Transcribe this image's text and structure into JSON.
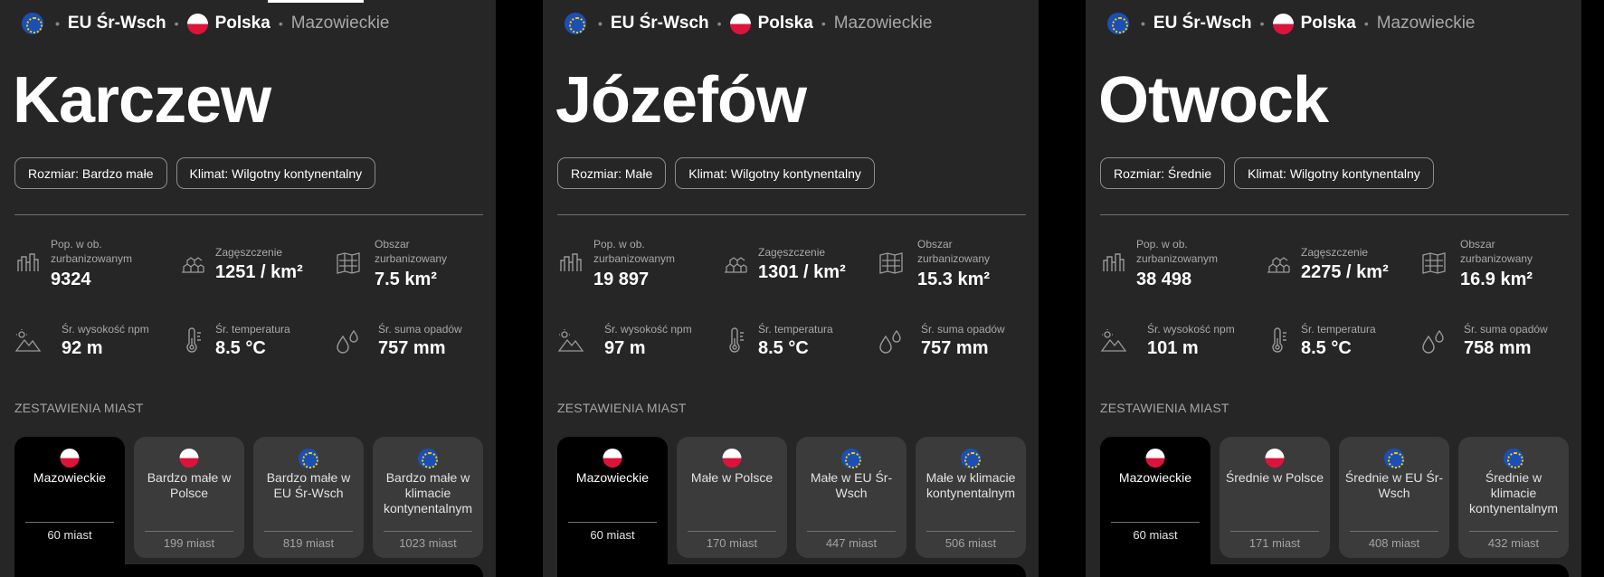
{
  "panels": [
    {
      "crumbs": {
        "region": "EU Śr-Wsch",
        "country": "Polska",
        "province": "Mazowieckie"
      },
      "title": "Karczew",
      "tags": {
        "size": "Rozmiar: Bardzo małe",
        "climate": "Klimat: Wilgotny kontynentalny"
      },
      "stats": {
        "pop_label": "Pop. w ob. zurbanizowanym",
        "pop_value": "9324",
        "density_label": "Zagęszczenie",
        "density_value": "1251 / km²",
        "area_label": "Obszar zurbanizowany",
        "area_value": "7.5 km²",
        "elev_label": "Śr. wysokość npm",
        "elev_value": "92 m",
        "temp_label": "Śr. temperatura",
        "temp_value": "8.5 °C",
        "rain_label": "Śr. suma opadów",
        "rain_value": "757 mm"
      },
      "section": "ZESTAWIENIA MIAST",
      "cards": [
        {
          "title": "Mazowieckie",
          "count": "60 miast"
        },
        {
          "title": "Bardzo małe w Polsce",
          "count": "199 miast"
        },
        {
          "title": "Bardzo małe w EU Śr-Wsch",
          "count": "819 miast"
        },
        {
          "title": "Bardzo małe w klimacie kontynentalnym",
          "count": "1023 miast"
        }
      ]
    },
    {
      "crumbs": {
        "region": "EU Śr-Wsch",
        "country": "Polska",
        "province": "Mazowieckie"
      },
      "title": "Józefów",
      "tags": {
        "size": "Rozmiar: Małe",
        "climate": "Klimat: Wilgotny kontynentalny"
      },
      "stats": {
        "pop_label": "Pop. w ob. zurbanizowanym",
        "pop_value": "19 897",
        "density_label": "Zagęszczenie",
        "density_value": "1301 / km²",
        "area_label": "Obszar zurbanizowany",
        "area_value": "15.3 km²",
        "elev_label": "Śr. wysokość npm",
        "elev_value": "97 m",
        "temp_label": "Śr. temperatura",
        "temp_value": "8.5 °C",
        "rain_label": "Śr. suma opadów",
        "rain_value": "757 mm"
      },
      "section": "ZESTAWIENIA MIAST",
      "cards": [
        {
          "title": "Mazowieckie",
          "count": "60 miast"
        },
        {
          "title": "Małe w Polsce",
          "count": "170 miast"
        },
        {
          "title": "Małe w EU Śr-Wsch",
          "count": "447 miast"
        },
        {
          "title": "Małe w klimacie kontynentalnym",
          "count": "506 miast"
        }
      ]
    },
    {
      "crumbs": {
        "region": "EU Śr-Wsch",
        "country": "Polska",
        "province": "Mazowieckie"
      },
      "title": "Otwock",
      "tags": {
        "size": "Rozmiar: Średnie",
        "climate": "Klimat: Wilgotny kontynentalny"
      },
      "stats": {
        "pop_label": "Pop. w ob. zurbanizowanym",
        "pop_value": "38 498",
        "density_label": "Zagęszczenie",
        "density_value": "2275 / km²",
        "area_label": "Obszar zurbanizowany",
        "area_value": "16.9 km²",
        "elev_label": "Śr. wysokość npm",
        "elev_value": "101 m",
        "temp_label": "Śr. temperatura",
        "temp_value": "8.5 °C",
        "rain_label": "Śr. suma opadów",
        "rain_value": "758 mm"
      },
      "section": "ZESTAWIENIA MIAST",
      "cards": [
        {
          "title": "Mazowieckie",
          "count": "60 miast"
        },
        {
          "title": "Średnie w Polsce",
          "count": "171 miast"
        },
        {
          "title": "Średnie w EU Śr-Wsch",
          "count": "408 miast"
        },
        {
          "title": "Średnie w klimacie kontynentalnym",
          "count": "432 miast"
        }
      ]
    }
  ],
  "icons": {
    "region": "eu-flag-icon",
    "country": "poland-flag-icon",
    "population": "city-skyline-icon",
    "density": "stacked-houses-icon",
    "area": "city-map-icon",
    "elevation": "mountain-sun-icon",
    "temperature": "thermometer-icon",
    "precipitation": "rain-drops-icon"
  },
  "colors": {
    "panel_bg": "#262626",
    "active_card": "#000000",
    "card_bg": "#3b3b3b",
    "poland_red": "#dc143c",
    "eu_blue": "#1c4fb4"
  }
}
